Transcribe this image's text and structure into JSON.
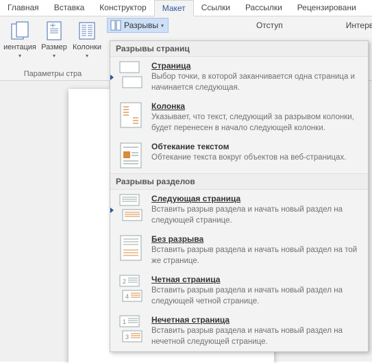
{
  "tabs": {
    "home": "Главная",
    "insert": "Вставка",
    "design": "Конструктор",
    "layout": "Макет",
    "references": "Ссылки",
    "mailings": "Рассылки",
    "review": "Рецензировани"
  },
  "ribbon": {
    "orientation": "иентация",
    "size": "Размер",
    "columns": "Колонки",
    "breaks": "Разрывы",
    "group_page_setup": "Параметры стра",
    "indent": "Отступ",
    "spacing": "Интервал"
  },
  "dropdown": {
    "section_page": "Разрывы страниц",
    "section_section": "Разрывы разделов",
    "page": {
      "title": "Страница",
      "desc": "Выбор точки, в которой заканчивается одна страница и начинается следующая."
    },
    "column": {
      "title": "Колонка",
      "desc": "Указывает, что текст, следующий за разрывом колонки, будет перенесен в начало следующей колонки."
    },
    "textwrap": {
      "title": "Обтекание текстом",
      "desc": "Обтекание текста вокруг объектов на веб-страницах."
    },
    "nextpage": {
      "title": "Следующая страница",
      "desc": "Вставить разрыв раздела и начать новый раздел на следующей странице."
    },
    "continuous": {
      "title": "Без разрыва",
      "desc": "Вставить разрыв раздела и начать новый раздел на той же странице."
    },
    "evenpage": {
      "title": "Четная страница",
      "desc": "Вставить разрыв раздела и начать новый раздел на следующей четной странице."
    },
    "oddpage": {
      "title": "Нечетная страница",
      "desc": "Вставить разрыв раздела и начать новый раздел на нечетной следующей странице."
    }
  }
}
